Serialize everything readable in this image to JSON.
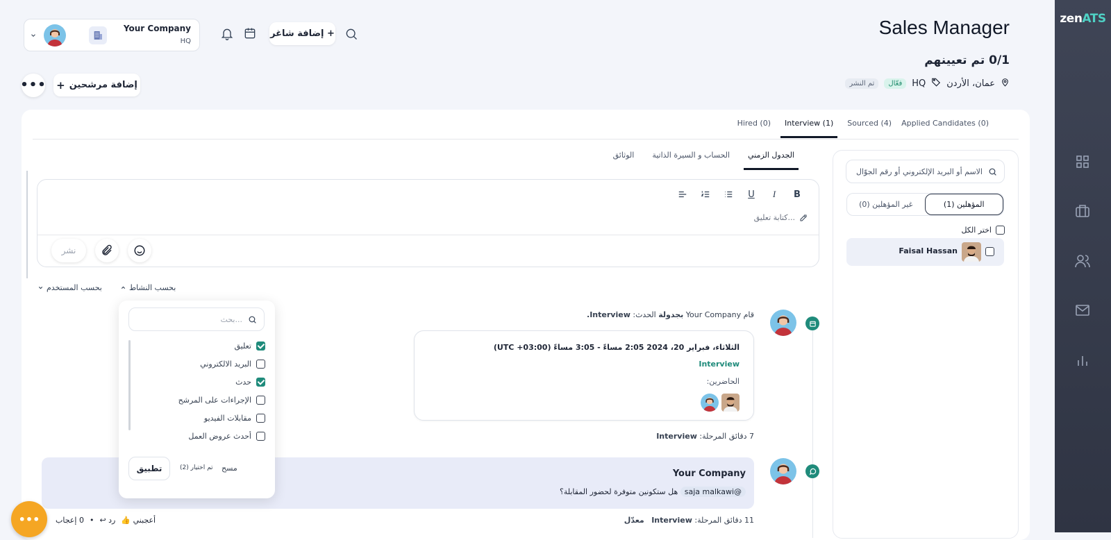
{
  "brand": {
    "logo_part1": "zen",
    "logo_part2": "ATS"
  },
  "job": {
    "title": "Sales Manager",
    "assigned": "0/1 تم تعيينهم",
    "location": "عمان، الأردن",
    "tag": "HQ",
    "status_active": "فعّال",
    "status_published": "تم النشر"
  },
  "header": {
    "company_name": "Your Company",
    "company_branch": "HQ",
    "add_vacancy": "+ إضافة شاغر",
    "add_candidates": "إضافة مرشحين"
  },
  "pipeline_tabs": [
    {
      "label": "Applied Candidates (0)"
    },
    {
      "label": "Sourced (4)"
    },
    {
      "label": "Interview (1)",
      "selected": true
    },
    {
      "label": "Hired (0)"
    }
  ],
  "candidates_panel": {
    "search_placeholder": "الاسم أو البريد الإلكتروني أو رقم الجوّال",
    "qualified": "المؤهلين (1)",
    "unqualified": "غير المؤهلين (0)",
    "select_all": "اختر الكل",
    "candidates": [
      {
        "name": "Faisal Hassan"
      }
    ]
  },
  "detail_tabs": [
    {
      "label": "الجدول الزمني",
      "selected": true
    },
    {
      "label": "الحساب و السيرة الذاتية"
    },
    {
      "label": "الوثائق"
    }
  ],
  "editor": {
    "placeholder": "كتابة تعليق...",
    "publish": "نشر",
    "tools": [
      "B",
      "I",
      "U",
      "bulleted-list",
      "numbered-list",
      "align"
    ]
  },
  "filters": {
    "by_user": "بحسب المستخدم",
    "by_activity": "بحسب النشاط"
  },
  "activity_dropdown": {
    "search_placeholder": "بحث...",
    "options": [
      {
        "label": "تعليق",
        "checked": true
      },
      {
        "label": "البريد الالكتروني",
        "checked": false
      },
      {
        "label": "حدث",
        "checked": true
      },
      {
        "label": "الإجراءات على المرشح",
        "checked": false
      },
      {
        "label": "مقابلات الفيديو",
        "checked": false
      },
      {
        "label": "أحدث عروض العمل",
        "checked": false
      }
    ],
    "clear": "مسح",
    "selected_count": "تم اختيار (2)",
    "apply": "تطبيق"
  },
  "timeline": {
    "event1": {
      "actor": "Your Company",
      "action_prefix": "قام",
      "action": "بجدولة",
      "action_suffix": "الحدث:",
      "event_name": "Interview.",
      "datetime": "الثلاثاء، فبراير 20، 2024 2:05 مساءً - 3:05 مساءً (UTC +03:00)",
      "card_title": "Interview",
      "attendees_label": "الحاضرين:",
      "meta_time": "7 دقائق",
      "meta_stage_label": "المرحلة:",
      "meta_stage": "Interview"
    },
    "event2": {
      "author": "Your Company",
      "mention": "@saja malkawi",
      "text": "هل ستكونين متوفرة لحضور المقابلة؟",
      "meta_time": "11 دقائق",
      "meta_stage_label": "المرحلة:",
      "meta_stage": "Interview",
      "edited": "معدّل",
      "like": "أعجبني",
      "reply": "رد",
      "likes_count": "0 إعجاب"
    }
  },
  "colors": {
    "accent": "#1f8b7b",
    "sidebar": "#3a4050",
    "fab": "#f5a623"
  }
}
